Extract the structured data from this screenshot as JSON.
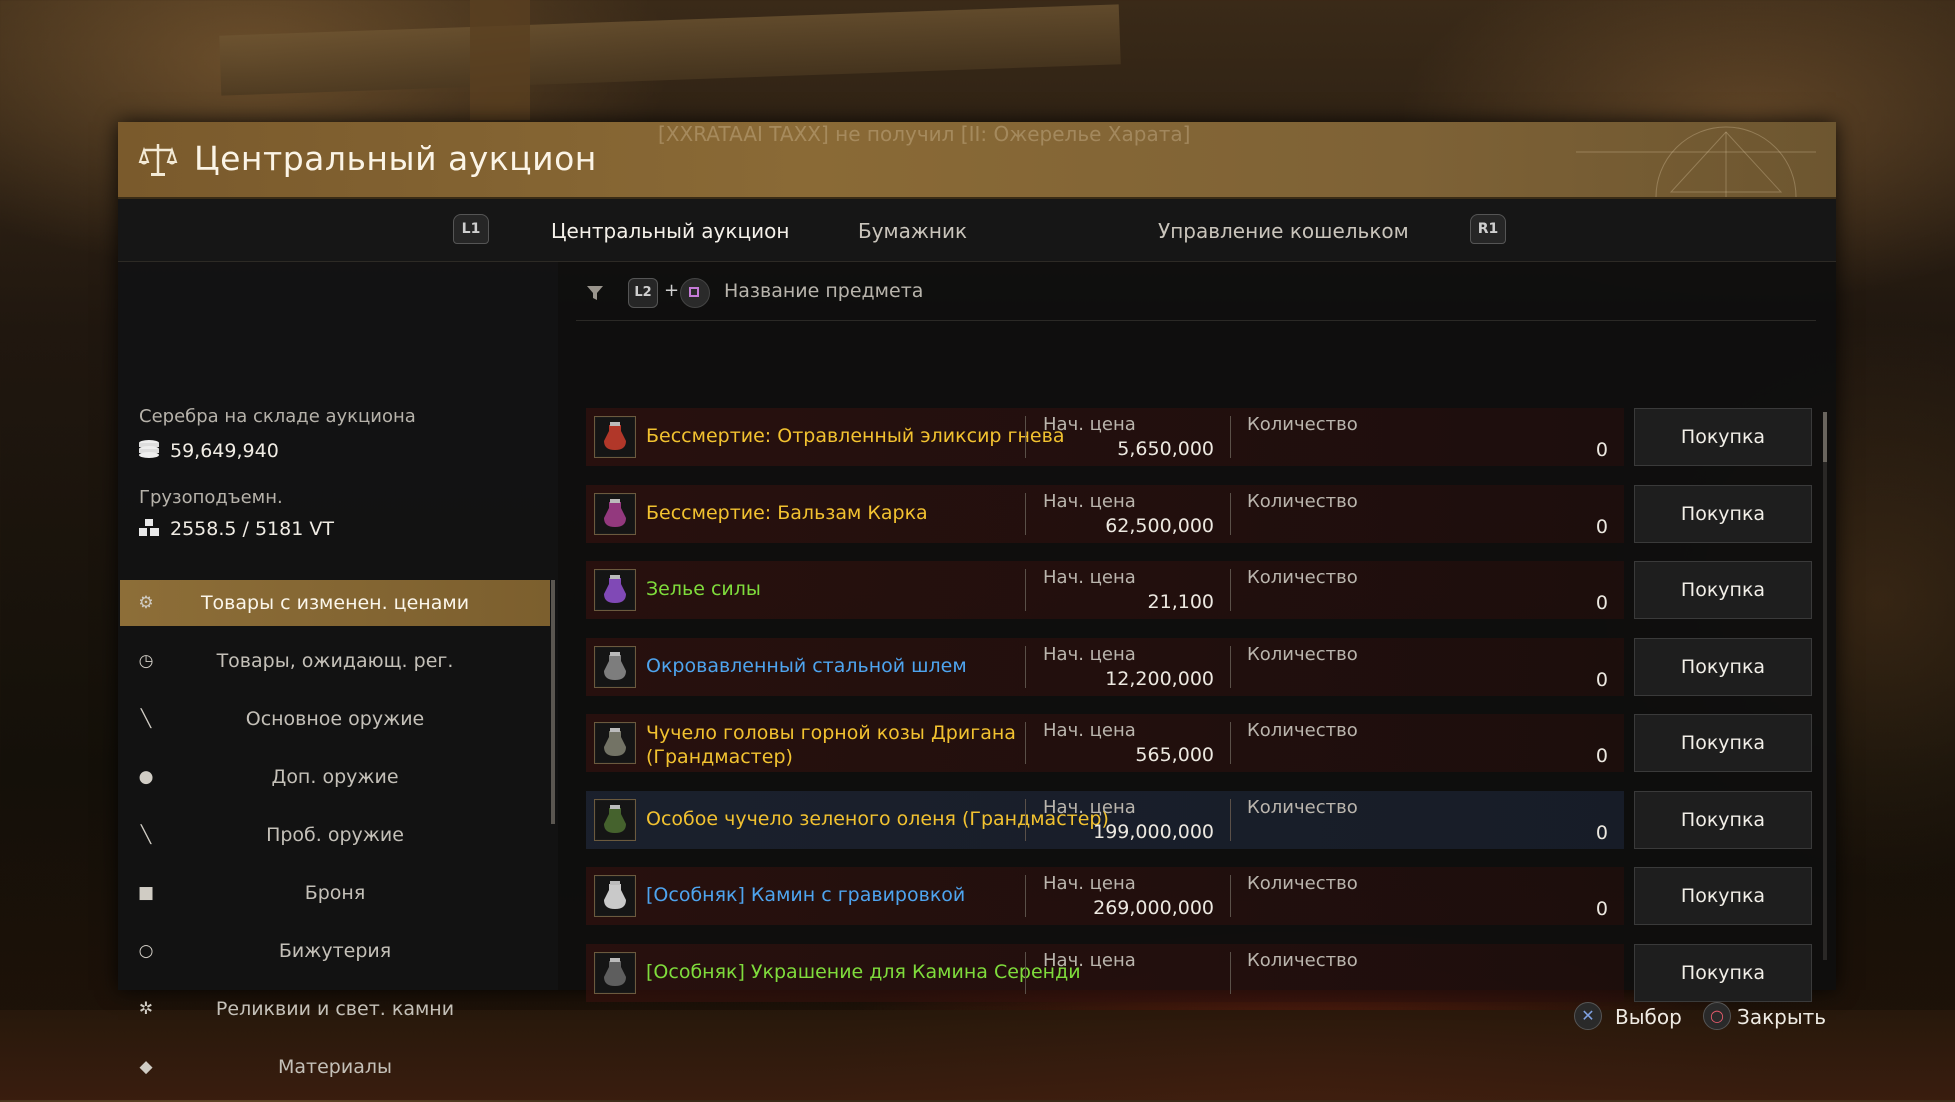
{
  "window": {
    "title": "Центральный аукцион",
    "ghost_message": "[XXRATAAI TAXX] не получил [II: Ожерелье Харата]"
  },
  "tabs": {
    "left_bumper": "L1",
    "right_bumper": "R1",
    "items": [
      "Центральный аукцион",
      "Бумажник",
      "Управление кошельком"
    ],
    "active_index": 0
  },
  "sidebar": {
    "silver_label": "Серебра на складе аукциона",
    "silver_value": "59,649,940",
    "weight_label": "Грузоподъемн.",
    "weight_value": "2558.5 / 5181 VT",
    "menu": [
      {
        "label": "Товары с изменен. ценами",
        "icon": "gear-icon",
        "active": true
      },
      {
        "label": "Товары, ожидающ. рег.",
        "icon": "clock-icon",
        "active": false
      },
      {
        "label": "Основное оружие",
        "icon": "sword-icon",
        "active": false
      },
      {
        "label": "Доп. оружие",
        "icon": "shield-icon",
        "active": false
      },
      {
        "label": "Проб. оружие",
        "icon": "dagger-icon",
        "active": false
      },
      {
        "label": "Броня",
        "icon": "armor-icon",
        "active": false
      },
      {
        "label": "Бижутерия",
        "icon": "ring-icon",
        "active": false
      },
      {
        "label": "Реликвии и свет. камни",
        "icon": "relic-icon",
        "active": false
      },
      {
        "label": "Материалы",
        "icon": "materials-icon",
        "active": false
      }
    ]
  },
  "filter": {
    "button": "L2",
    "plus": "+",
    "search_label": "Название предмета"
  },
  "columns": {
    "price_label": "Нач. цена",
    "qty_label": "Количество",
    "buy_label": "Покупка"
  },
  "items": [
    {
      "name": "Бессмертие: Отравленный эликсир гнева",
      "color": "#f2c230",
      "price": "5,650,000",
      "qty": "0",
      "icon": "elixir-icon"
    },
    {
      "name": "Бессмертие: Бальзам Карка",
      "color": "#f2c230",
      "price": "62,500,000",
      "qty": "0",
      "icon": "balm-icon"
    },
    {
      "name": "Зелье силы",
      "color": "#7fdc3c",
      "price": "21,100",
      "qty": "0",
      "icon": "potion-icon"
    },
    {
      "name": "Окровавленный стальной шлем",
      "color": "#4ea4ee",
      "price": "12,200,000",
      "qty": "0",
      "icon": "helmet-icon"
    },
    {
      "name": "Чучело головы горной козы Дригана",
      "name2": "(Грандмастер)",
      "color": "#f2c230",
      "price": "565,000",
      "qty": "0",
      "icon": "goat-trophy-icon"
    },
    {
      "name": "Особое чучело зеленого оленя (Грандмастер)",
      "color": "#f2c230",
      "price": "199,000,000",
      "qty": "0",
      "icon": "deer-trophy-icon",
      "selected": true
    },
    {
      "name": "[Особняк] Камин с гравировкой",
      "color": "#4ea4ee",
      "price": "269,000,000",
      "qty": "0",
      "icon": "fireplace-icon"
    },
    {
      "name": "[Особняк] Украшение для Камина Серенди",
      "color": "#7fdc3c",
      "price": "",
      "qty": "",
      "icon": "decor-icon"
    }
  ],
  "hints": {
    "select": "Выбор",
    "close": "Закрыть"
  },
  "colors": {
    "accent_gold": "#8d6e38",
    "rare_yellow": "#f2c230",
    "blue": "#4ea4ee",
    "green": "#7fdc3c"
  }
}
